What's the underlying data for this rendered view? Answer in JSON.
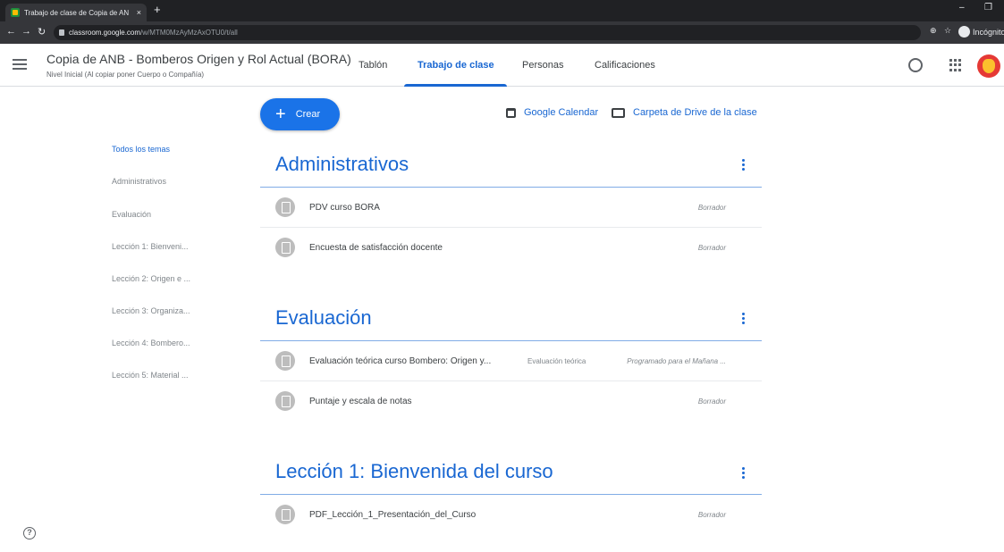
{
  "browser": {
    "tab_title": "Trabajo de clase de Copia de AN",
    "tab_close": "×",
    "new_tab": "+",
    "url_host": "classroom.google.com",
    "url_path": "/w/MTM0MzAyMzAxOTU0/t/all",
    "incognito_label": "Incógnito",
    "minimize": "–",
    "restore": "❐"
  },
  "header": {
    "class_title": "Copia de ANB - Bomberos Origen y Rol Actual (BORA)",
    "class_subtitle": "Nivel Inicial (Al copiar poner Cuerpo o Compañía)",
    "tabs": [
      {
        "label": "Tablón"
      },
      {
        "label": "Trabajo de clase"
      },
      {
        "label": "Personas"
      },
      {
        "label": "Calificaciones"
      }
    ],
    "active_tab": "Trabajo de clase"
  },
  "actions": {
    "create_label": "Crear",
    "calendar_label": "Google Calendar",
    "drive_label": "Carpeta de Drive de la clase"
  },
  "topics": [
    {
      "label": "Todos los temas"
    },
    {
      "label": "Administrativos"
    },
    {
      "label": "Evaluación"
    },
    {
      "label": "Lección 1: Bienveni..."
    },
    {
      "label": "Lección 2: Origen e ..."
    },
    {
      "label": "Lección 3: Organiza..."
    },
    {
      "label": "Lección 4: Bombero..."
    },
    {
      "label": "Lección 5: Material ..."
    }
  ],
  "sections": [
    {
      "title": "Administrativos",
      "items": [
        {
          "title": "PDV curso BORA",
          "topic": "",
          "status": "Borrador"
        },
        {
          "title": "Encuesta de satisfacción docente",
          "topic": "",
          "status": "Borrador"
        }
      ]
    },
    {
      "title": "Evaluación",
      "items": [
        {
          "title": "Evaluación teórica curso Bombero: Origen y...",
          "topic": "Evaluación teórica",
          "status": "Programado para el Mañana ..."
        },
        {
          "title": "Puntaje y escala de notas",
          "topic": "",
          "status": "Borrador"
        }
      ]
    },
    {
      "title": "Lección 1: Bienvenida del curso",
      "items": [
        {
          "title": "PDF_Lección_1_Presentación_del_Curso",
          "topic": "",
          "status": "Borrador"
        }
      ]
    }
  ],
  "colors": {
    "accent": "#1967d2",
    "create_button": "#1a73e8",
    "chrome_dark": "#202124"
  },
  "help_icon": "?"
}
